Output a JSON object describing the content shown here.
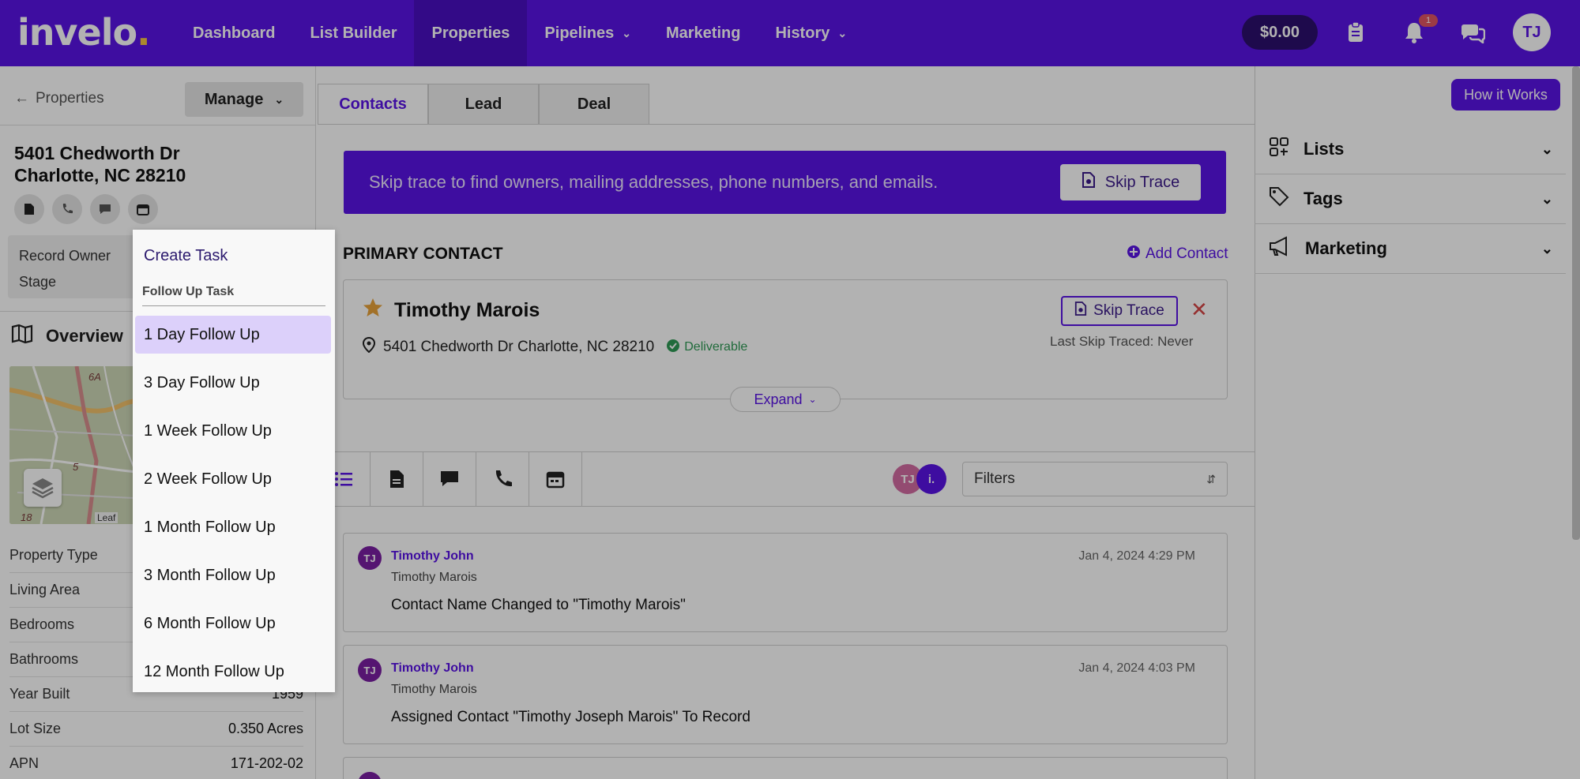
{
  "app": {
    "logo": "invelo",
    "logo_dot": "."
  },
  "nav": {
    "items": [
      {
        "label": "Dashboard",
        "chevron": false
      },
      {
        "label": "List Builder",
        "chevron": false
      },
      {
        "label": "Properties",
        "chevron": false
      },
      {
        "label": "Pipelines",
        "chevron": true
      },
      {
        "label": "Marketing",
        "chevron": false
      },
      {
        "label": "History",
        "chevron": true
      }
    ],
    "active": "Properties",
    "balance": "$0.00",
    "notification_count": "1",
    "avatar_initials": "TJ"
  },
  "left": {
    "back_label": "Properties",
    "manage_label": "Manage",
    "address_line1": "5401 Chedworth Dr",
    "address_line2": "Charlotte, NC 28210",
    "record_owner_label": "Record Owner",
    "stage_label": "Stage",
    "overview_label": "Overview",
    "map_attrib": "Leaf",
    "properties": [
      {
        "label": "Property Type",
        "value": ""
      },
      {
        "label": "Living Area",
        "value": ""
      },
      {
        "label": "Bedrooms",
        "value": ""
      },
      {
        "label": "Bathrooms",
        "value": ""
      },
      {
        "label": "Year Built",
        "value": "1959"
      },
      {
        "label": "Lot Size",
        "value": "0.350 Acres"
      },
      {
        "label": "APN",
        "value": "171-202-02"
      }
    ]
  },
  "tabs": [
    "Contacts",
    "Lead",
    "Deal"
  ],
  "banner": {
    "text": "Skip trace to find owners, mailing addresses, phone numbers, and emails.",
    "button": "Skip Trace"
  },
  "primary": {
    "title": "PRIMARY CONTACT",
    "add_contact": "Add Contact",
    "name": "Timothy Marois",
    "address": "5401 Chedworth Dr Charlotte, NC 28210",
    "deliverable": "Deliverable",
    "skip_button": "Skip Trace",
    "last_skip": "Last Skip Traced: Never",
    "expand": "Expand"
  },
  "activity": {
    "filters_label": "Filters",
    "user_dots": [
      "TJ",
      "i."
    ],
    "items": [
      {
        "initials": "TJ",
        "author": "Timothy John",
        "sub": "Timothy Marois",
        "text": "Contact Name Changed to \"Timothy Marois\"",
        "date": "Jan 4, 2024 4:29 PM"
      },
      {
        "initials": "TJ",
        "author": "Timothy John",
        "sub": "Timothy Marois",
        "text": "Assigned Contact \"Timothy Joseph Marois\" To Record",
        "date": "Jan 4, 2024 4:03 PM"
      }
    ]
  },
  "right": {
    "how_it_works": "How it Works",
    "sections": [
      "Lists",
      "Tags",
      "Marketing"
    ]
  },
  "menu": {
    "title": "Create Task",
    "subtitle": "Follow Up Task",
    "items": [
      "1 Day Follow Up",
      "3 Day Follow Up",
      "1 Week Follow Up",
      "2 Week Follow Up",
      "1 Month Follow Up",
      "3 Month Follow Up",
      "6 Month Follow Up",
      "12 Month Follow Up"
    ],
    "active_index": 0
  },
  "colors": {
    "brand": "#5a14e6",
    "nav_dark": "#2b0f6e",
    "deliverable": "#2e9a55",
    "danger": "#d64545"
  }
}
